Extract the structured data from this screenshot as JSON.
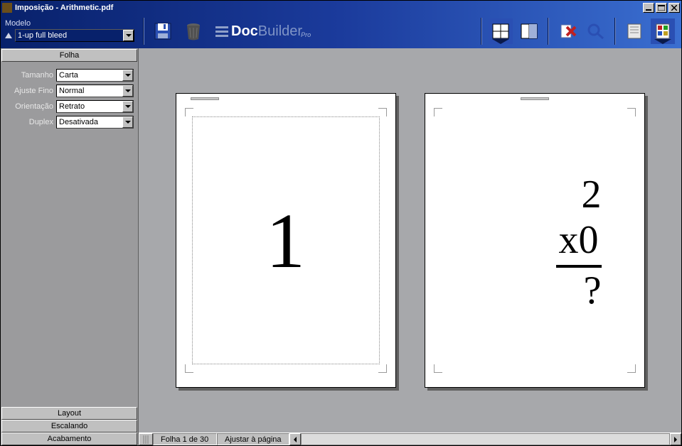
{
  "window": {
    "title": "Imposição - Arithmetic.pdf"
  },
  "toolbar": {
    "modelo_label": "Modelo",
    "modelo_value": "1-up full bleed",
    "brand_prefix": "Doc",
    "brand_suffix": "Builder",
    "brand_sub": "Pro"
  },
  "sidebar": {
    "tabs": {
      "folha": "Folha",
      "layout": "Layout",
      "escalando": "Escalando",
      "acabamento": "Acabamento"
    },
    "fields": {
      "tamanho_label": "Tamanho",
      "tamanho_value": "Carta",
      "ajuste_label": "Ajuste Fino",
      "ajuste_value": "Normal",
      "orientacao_label": "Orientação",
      "orientacao_value": "Retrato",
      "duplex_label": "Duplex",
      "duplex_value": "Desativada"
    }
  },
  "pages": {
    "page1_text": "1",
    "page2_line1": "2",
    "page2_line2": "x0",
    "page2_line3": "?"
  },
  "status": {
    "sheet": "Folha 1 de 30",
    "zoom": "Ajustar à página"
  }
}
